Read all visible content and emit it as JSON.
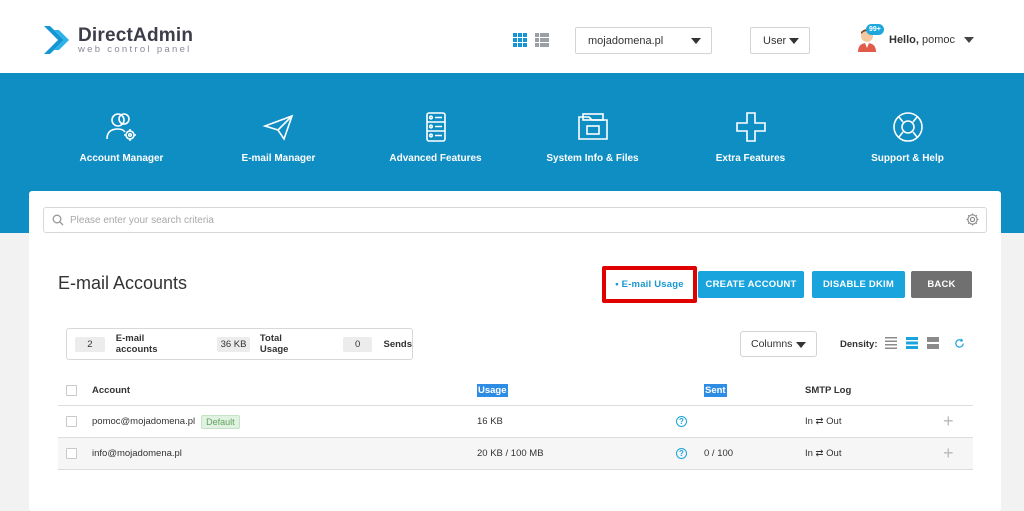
{
  "brand": {
    "name": "DirectAdmin",
    "tagline": "web control panel"
  },
  "header": {
    "domain_select": "mojadomena.pl",
    "level_select": "User",
    "notification_count": "99+",
    "hello": "Hello,",
    "username": "pomoc"
  },
  "nav": [
    {
      "label": "Account Manager",
      "icon": "users-gear-icon"
    },
    {
      "label": "E-mail Manager",
      "icon": "paper-plane-icon"
    },
    {
      "label": "Advanced Features",
      "icon": "server-icon"
    },
    {
      "label": "System Info & Files",
      "icon": "folder-icon"
    },
    {
      "label": "Extra Features",
      "icon": "plus-icon"
    },
    {
      "label": "Support & Help",
      "icon": "lifebuoy-icon"
    }
  ],
  "search": {
    "placeholder": "Please enter your search criteria"
  },
  "page": {
    "title": "E-mail Accounts",
    "buttons": {
      "usage": "• E-mail Usage",
      "create": "CREATE ACCOUNT",
      "dkim": "DISABLE DKIM",
      "back": "BACK"
    }
  },
  "stats": [
    {
      "value": "2",
      "label": "E-mail accounts"
    },
    {
      "value": "36 KB",
      "label": "Total Usage"
    },
    {
      "value": "0",
      "label": "Sends"
    }
  ],
  "toolbar": {
    "columns": "Columns",
    "density": "Density:"
  },
  "table": {
    "headers": {
      "account": "Account",
      "usage": "Usage",
      "sent": "Sent",
      "smtp": "SMTP Log"
    },
    "rows": [
      {
        "account": "pomoc@mojadomena.pl",
        "tag": "Default",
        "usage": "16 KB",
        "sent": "",
        "smtp": "In ⇄ Out"
      },
      {
        "account": "info@mojadomena.pl",
        "tag": "",
        "usage": "20 KB / 100 MB",
        "sent": "0 / 100",
        "smtp": "In ⇄ Out"
      }
    ]
  },
  "colors": {
    "accent": "#1aa4dd",
    "band": "#0f8ec3",
    "highlight_border": "#e00000",
    "back_button": "#707070"
  }
}
